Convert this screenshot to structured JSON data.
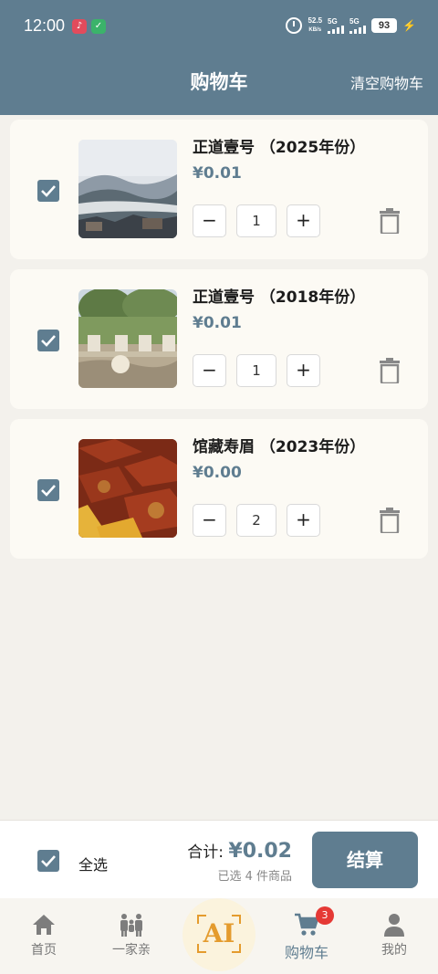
{
  "status_bar": {
    "time": "12:00",
    "net_speed": "52.5",
    "net_unit": "KB/s",
    "sim1": "5G",
    "sim2": "5G",
    "battery": "93"
  },
  "header": {
    "title": "购物车",
    "clear_label": "清空购物车"
  },
  "cart": {
    "items": [
      {
        "name": "正道壹号 （2025年份）",
        "price": "¥0.01",
        "quantity": "1",
        "checked": true
      },
      {
        "name": "正道壹号 （2018年份）",
        "price": "¥0.01",
        "quantity": "1",
        "checked": true
      },
      {
        "name": "馆藏寿眉 （2023年份）",
        "price": "¥0.00",
        "quantity": "2",
        "checked": true
      }
    ],
    "minus_label": "−",
    "plus_label": "+"
  },
  "footer": {
    "select_all_label": "全选",
    "total_label": "合计: ",
    "total_value": "¥0.02",
    "selected_count": "已选 4 件商品",
    "checkout_label": "结算"
  },
  "nav": {
    "items": [
      {
        "label": "首页",
        "icon": "home-icon"
      },
      {
        "label": "一家亲",
        "icon": "family-icon"
      },
      {
        "label": "AI",
        "icon": "ai-icon"
      },
      {
        "label": "购物车",
        "icon": "cart-icon",
        "badge": "3"
      },
      {
        "label": "我的",
        "icon": "person-icon"
      }
    ]
  },
  "colors": {
    "primary": "#5f7d90",
    "background": "#f3f1ec",
    "card": "#fcfaf4",
    "accent": "#e49b2d",
    "badge": "#e53935"
  }
}
